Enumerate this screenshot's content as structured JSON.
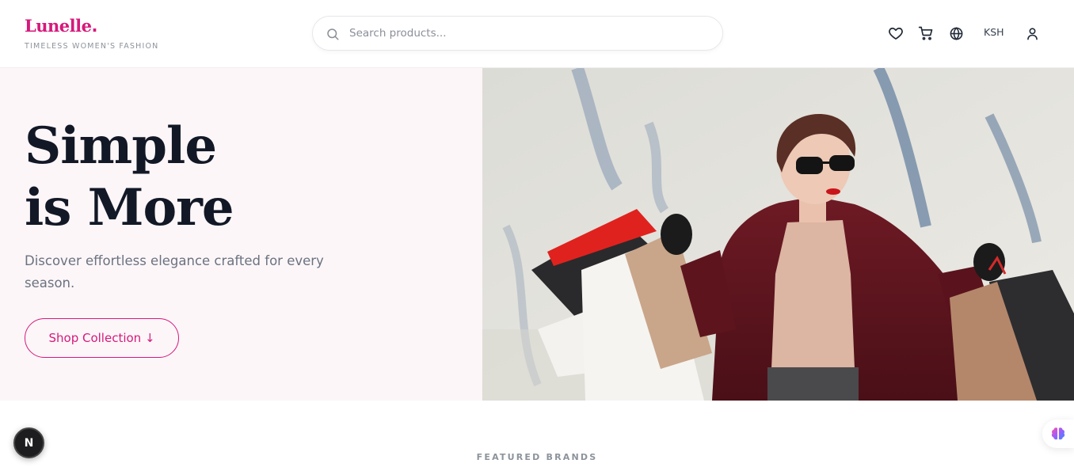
{
  "header": {
    "brand_name": "Lunelle",
    "brand_dot": ".",
    "tagline": "TIMELESS WOMEN'S FASHION",
    "search_placeholder": "Search products...",
    "currency": "KSH",
    "icons": [
      "heart-icon",
      "cart-icon",
      "globe-icon",
      "user-icon"
    ]
  },
  "hero": {
    "title_line1": "Simple",
    "title_line2": "is More",
    "subtitle": "Discover effortless elegance crafted for every season.",
    "cta_label": "Shop Collection ↓"
  },
  "featured_heading": "FEATURED BRANDS",
  "dev_badge": "N",
  "colors": {
    "brand": "#d6197c",
    "heading": "#121826",
    "muted": "#6b7280",
    "hero_bg": "#fcf6f8"
  }
}
